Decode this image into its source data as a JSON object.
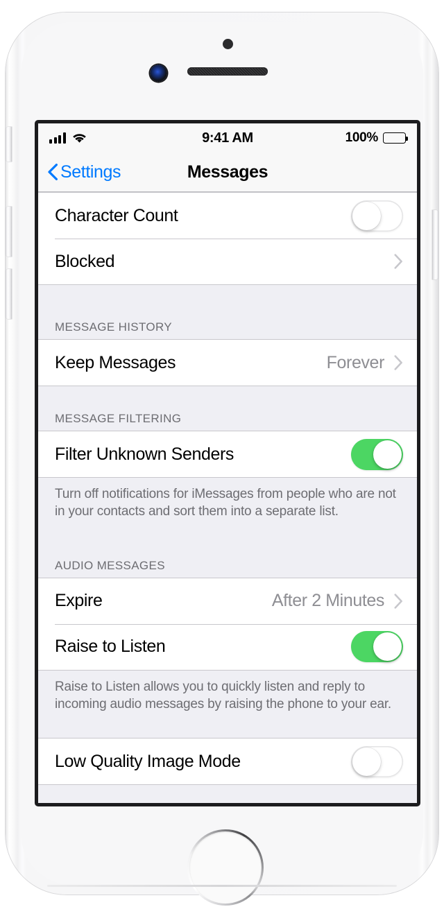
{
  "status_bar": {
    "signal_icon": "cellular-signal-icon",
    "signal_bars_total": 4,
    "signal_bars_filled": 4,
    "wifi_icon": "wifi-icon",
    "time": "9:41 AM",
    "battery_percent": "100%",
    "battery_icon": "battery-full-icon"
  },
  "nav_bar": {
    "back_icon": "chevron-left-icon",
    "back_label": "Settings",
    "title": "Messages"
  },
  "colors": {
    "accent_blue": "#007aff",
    "switch_on_green": "#4cd663",
    "secondary_text": "#8e8e93",
    "group_background": "#efeff4",
    "separator": "#c8c7cc"
  },
  "sections": [
    {
      "header": null,
      "rows": [
        {
          "label": "Character Count",
          "control": "switch",
          "value": "off"
        },
        {
          "label": "Blocked",
          "control": "disclosure",
          "value": ""
        }
      ],
      "footer": null
    },
    {
      "header": "MESSAGE HISTORY",
      "rows": [
        {
          "label": "Keep Messages",
          "control": "disclosure",
          "value": "Forever"
        }
      ],
      "footer": null
    },
    {
      "header": "MESSAGE FILTERING",
      "rows": [
        {
          "label": "Filter Unknown Senders",
          "control": "switch",
          "value": "on"
        }
      ],
      "footer": "Turn off notifications for iMessages from people who are not in your contacts and sort them into a separate list."
    },
    {
      "header": "AUDIO MESSAGES",
      "rows": [
        {
          "label": "Expire",
          "control": "disclosure",
          "value": "After 2 Minutes"
        },
        {
          "label": "Raise to Listen",
          "control": "switch",
          "value": "on"
        }
      ],
      "footer": "Raise to Listen allows you to quickly listen and reply to incoming audio messages by raising the phone to your ear."
    },
    {
      "header": null,
      "rows": [
        {
          "label": "Low Quality Image Mode",
          "control": "switch",
          "value": "off"
        }
      ],
      "footer": null
    }
  ],
  "device": {
    "sensor_icon": "proximity-sensor-icon",
    "camera_icon": "front-camera-icon",
    "earpiece_icon": "earpiece-speaker-icon",
    "home_button_icon": "home-button-icon",
    "silent_switch_icon": "ring-silent-switch-icon",
    "volume_up_icon": "volume-up-button-icon",
    "volume_down_icon": "volume-down-button-icon",
    "power_icon": "power-button-icon"
  }
}
